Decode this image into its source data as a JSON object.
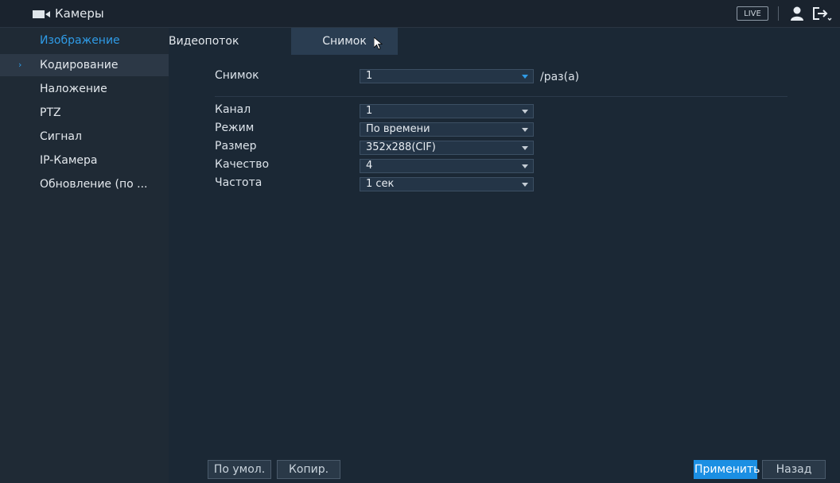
{
  "header": {
    "title": "Камеры",
    "camera_icon": "camera-icon",
    "live_label": "LIVE",
    "user_icon": "user-icon",
    "logout_icon": "logout-icon"
  },
  "sidebar": {
    "section": "Изображение",
    "items": [
      {
        "label": "Кодирование",
        "active": true
      },
      {
        "label": "Наложение"
      },
      {
        "label": "PTZ"
      },
      {
        "label": "Сигнал"
      },
      {
        "label": "IP-Камера"
      },
      {
        "label": "Обновление (по ..."
      }
    ]
  },
  "tabs": [
    {
      "label": "Видеопоток"
    },
    {
      "label": "Снимок",
      "active": true
    }
  ],
  "form": {
    "snapshot": {
      "label": "Снимок",
      "value": "1",
      "unit": "/раз(а)"
    },
    "channel": {
      "label": "Канал",
      "value": "1"
    },
    "mode": {
      "label": "Режим",
      "value": "По времени"
    },
    "size": {
      "label": "Размер",
      "value": "352x288(CIF)"
    },
    "quality": {
      "label": "Качество",
      "value": "4"
    },
    "interval": {
      "label": "Частота",
      "value": "1 сек"
    }
  },
  "buttons": {
    "default": "По умол.",
    "copy": "Копир.",
    "apply": "Применить",
    "back": "Назад"
  },
  "colors": {
    "accent": "#1b8fe3",
    "background": "#1c2530",
    "sidebar": "#1f2a35"
  }
}
